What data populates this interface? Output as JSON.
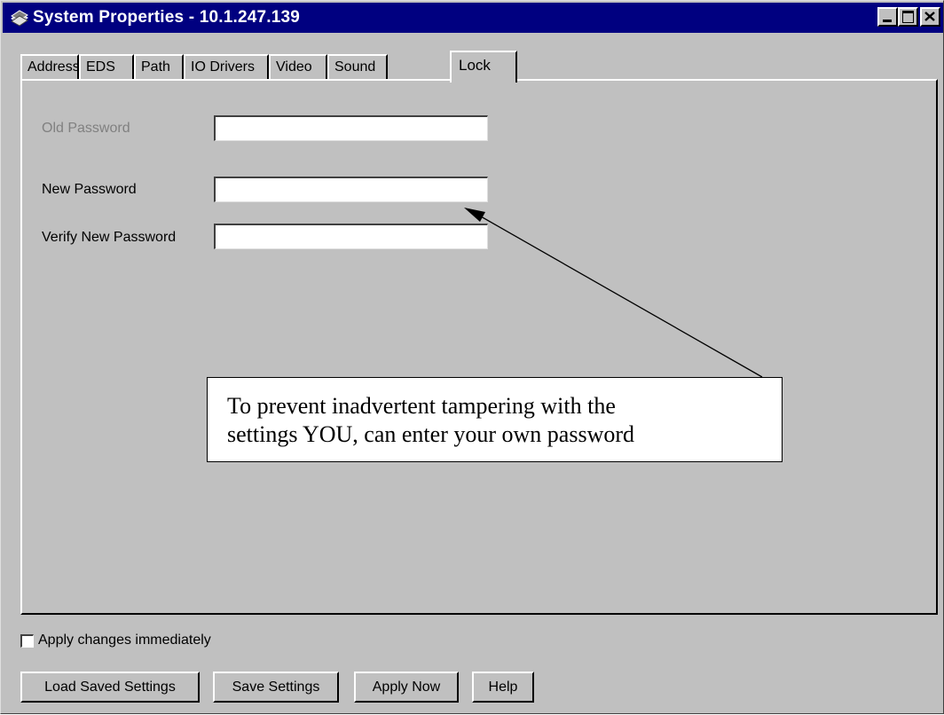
{
  "window": {
    "title": "System Properties - 10.1.247.139",
    "titlebar_color": "#000080",
    "face_color": "#c0c0c0",
    "icons": {
      "app": "system-properties-icon",
      "minimize": "minimize-icon",
      "maximize": "maximize-icon",
      "close": "close-icon"
    }
  },
  "tabs": [
    {
      "label": "Address"
    },
    {
      "label": "EDS"
    },
    {
      "label": "Path"
    },
    {
      "label": "IO Drivers"
    },
    {
      "label": "Video"
    },
    {
      "label": "Sound"
    },
    {
      "label": "Lock"
    }
  ],
  "active_tab": "Lock",
  "lock": {
    "old_password_label": "Old Password",
    "old_password_value": "",
    "new_password_label": "New Password",
    "new_password_value": "",
    "verify_password_label": "Verify New Password",
    "verify_password_value": ""
  },
  "callout": {
    "line1": "To prevent inadvertent tampering with the",
    "line2": "settings YOU, can enter your own password"
  },
  "footer": {
    "apply_immediately_label": "Apply changes immediately",
    "apply_immediately_checked": false,
    "buttons": {
      "load": "Load Saved Settings",
      "save": "Save Settings",
      "apply": "Apply Now",
      "help": "Help"
    }
  }
}
